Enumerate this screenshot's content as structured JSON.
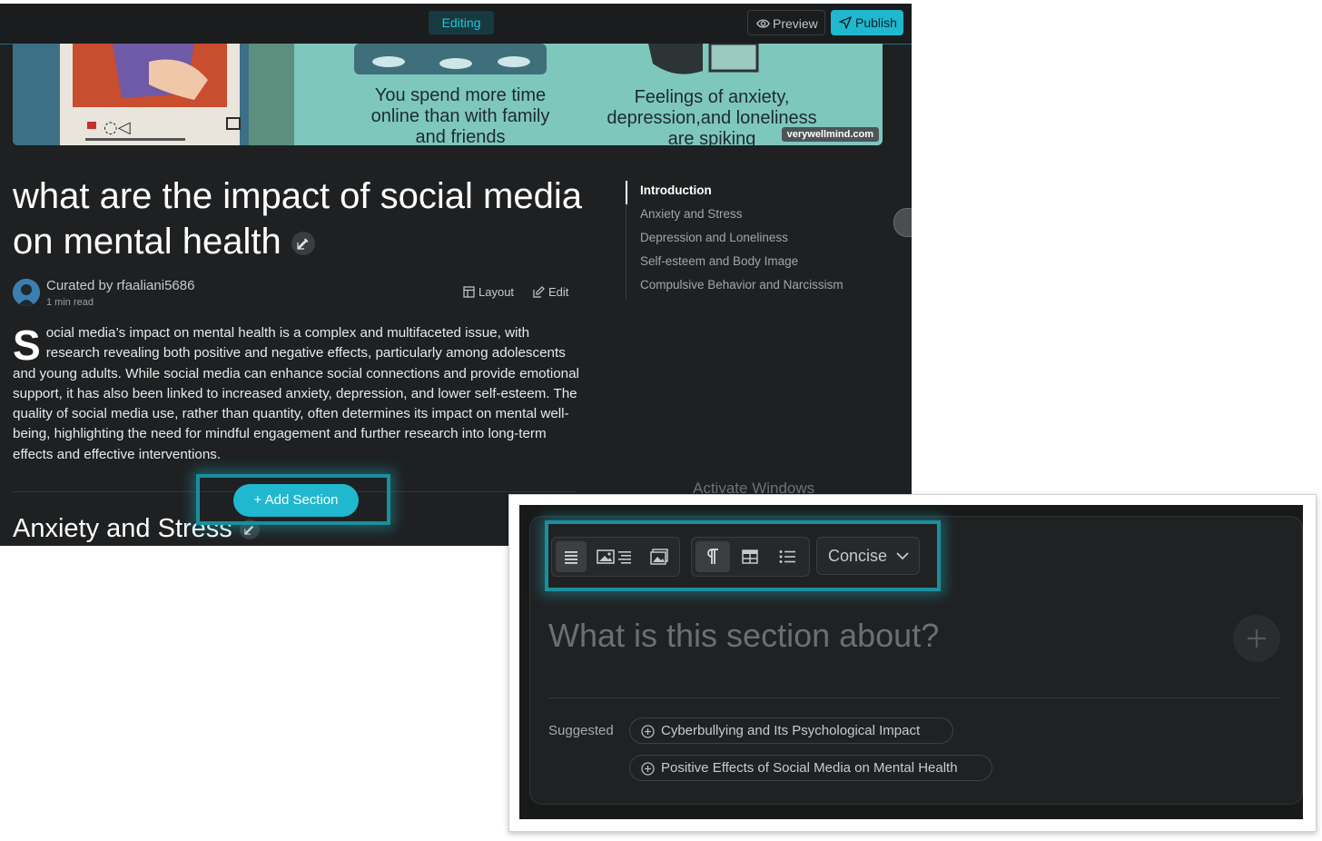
{
  "topbar": {
    "editing_label": "Editing",
    "preview_label": "Preview",
    "publish_label": "Publish"
  },
  "hero": {
    "caption_left": "You spend more time online than with family and friends",
    "caption_right": "Feelings of anxiety, depression,and loneliness are spiking",
    "credit": "verywellmind.com"
  },
  "article": {
    "title": "what are the impact of social media on mental health",
    "curated_by": "Curated by rfaaliani5686",
    "read_time": "1 min read",
    "layout_label": "Layout",
    "edit_label": "Edit",
    "intro_dropcap": "S",
    "intro_text": "ocial media’s impact on mental health is a complex and multifaceted issue, with research revealing both positive and negative effects, particularly among adolescents and young adults. While social media can enhance social connections and provide emotional support, it has also been linked to increased anxiety, depression, and lower self-esteem. The quality of social media use, rather than quantity, often determines its impact on mental well-being, highlighting the need for mindful engagement and further research into long-term effects and effective interventions.",
    "add_section_label": "+ Add Section",
    "next_section_title": "Anxiety and Stress"
  },
  "toc": {
    "items": [
      {
        "label": "Introduction",
        "active": true
      },
      {
        "label": "Anxiety and Stress",
        "active": false
      },
      {
        "label": "Depression and Loneliness",
        "active": false
      },
      {
        "label": "Self-esteem and Body Image",
        "active": false
      },
      {
        "label": "Compulsive Behavior and Narcissism",
        "active": false
      }
    ]
  },
  "watermark": "Activate Windows",
  "composer": {
    "style_label": "Concise",
    "placeholder": "What is this section about?",
    "suggested_label": "Suggested",
    "suggestions": [
      "Cyberbullying and Its Psychological Impact",
      "Positive Effects of Social Media on Mental Health"
    ]
  },
  "colors": {
    "accent": "#1fb8cf",
    "background": "#1f2021",
    "glow": "#1a8f9d"
  }
}
